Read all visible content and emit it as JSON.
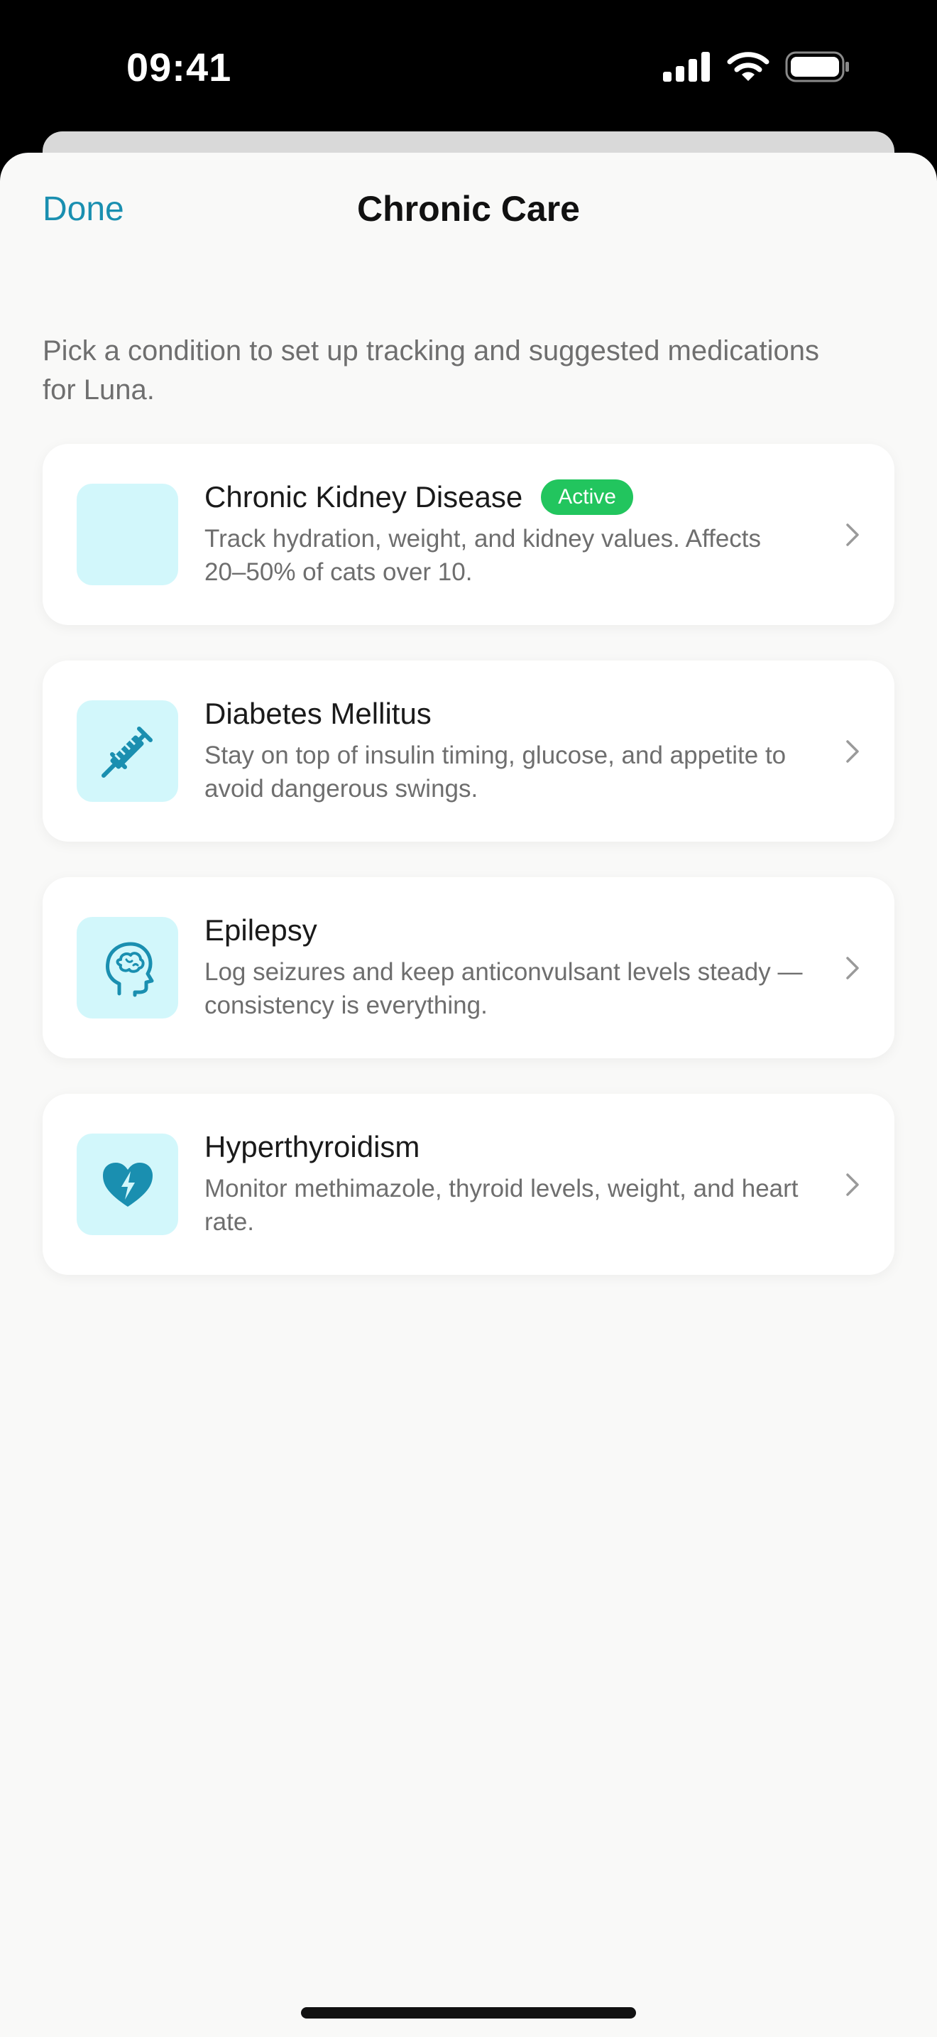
{
  "status_bar": {
    "time": "09:41"
  },
  "nav": {
    "done_label": "Done",
    "title": "Chronic Care"
  },
  "intro": "Pick a condition to set up tracking and suggested medications for Luna.",
  "conditions": [
    {
      "title": "Chronic Kidney Disease",
      "badge": "Active",
      "description": "Track hydration, weight, and kidney values. Affects 20–50% of cats over 10.",
      "icon": "blank"
    },
    {
      "title": "Diabetes Mellitus",
      "description": "Stay on top of insulin timing, glucose, and appetite to avoid dangerous swings.",
      "icon": "syringe-icon"
    },
    {
      "title": "Epilepsy",
      "description": "Log seizures and keep anticonvulsant levels steady — consistency is everything.",
      "icon": "brain-head-icon"
    },
    {
      "title": "Hyperthyroidism",
      "description": "Monitor methimazole, thyroid levels, weight, and heart rate.",
      "icon": "heart-bolt-icon"
    }
  ],
  "colors": {
    "accent": "#1a8fb0",
    "icon_tile": "#d2f7fb",
    "active_badge": "#22c55e",
    "sheet_background": "#f9f9f8"
  }
}
